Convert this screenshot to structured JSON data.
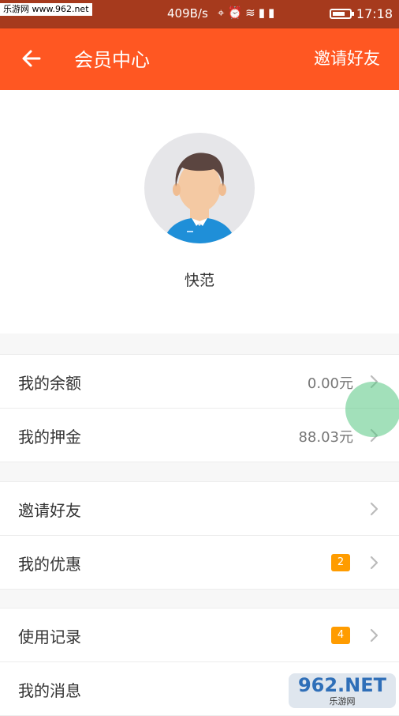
{
  "status_bar": {
    "watermark": "乐游网 www.962.net",
    "network_speed": "409B/s",
    "icons": [
      "location-icon",
      "alarm-icon",
      "wifi-icon",
      "signal-3g-icon",
      "signal-icon"
    ],
    "battery_level": 0.75,
    "time": "17:18"
  },
  "header": {
    "title": "会员中心",
    "action": "邀请好友"
  },
  "profile": {
    "username": "快范"
  },
  "menu_groups": [
    {
      "items": [
        {
          "label": "我的余额",
          "value": "0.00元"
        },
        {
          "label": "我的押金",
          "value": "88.03元"
        }
      ]
    },
    {
      "items": [
        {
          "label": "邀请好友",
          "value": ""
        },
        {
          "label": "我的优惠",
          "badge": "2"
        }
      ]
    },
    {
      "items": [
        {
          "label": "使用记录",
          "badge": "4"
        },
        {
          "label": "我的消息"
        }
      ]
    }
  ],
  "watermark_logo": {
    "text": "962.NET",
    "subtext": "乐游网"
  },
  "colors": {
    "primary": "#ff5722",
    "status_bar": "#a63a1d",
    "badge": "#ff9c00"
  }
}
